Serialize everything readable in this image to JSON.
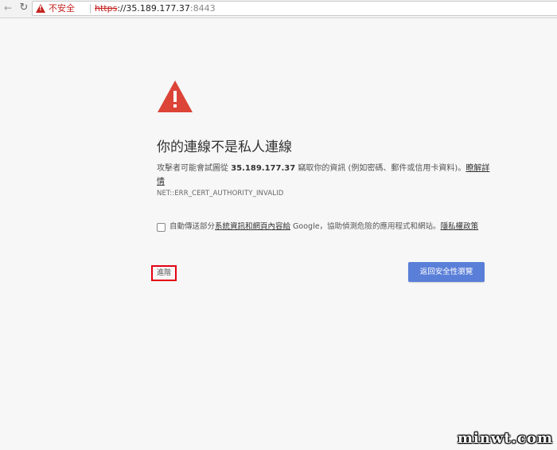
{
  "browser": {
    "back_icon": "←",
    "reload_icon": "↻",
    "not_secure_label": "不安全",
    "url_scheme": "https",
    "url_host": "://35.189.177.37",
    "url_port": ":8443"
  },
  "interstitial": {
    "heading": "你的連線不是私人連線",
    "message_before": "攻擊者可能會試圖從 ",
    "message_host": "35.189.177.37",
    "message_after": " 竊取你的資訊 (例如密碼、郵件或信用卡資料)。",
    "learn_more": "瞭解詳情",
    "error_code": "NET::ERR_CERT_AUTHORITY_INVALID",
    "report_before": "自動傳送部分",
    "report_link": "系統資訊和網頁內容給",
    "report_after": " Google，協助偵測危險的應用程式和網站。",
    "privacy_link": "隱私權政策",
    "advanced_button": "進階",
    "back_to_safety_button": "返回安全性瀏覽",
    "warning_color": "#db4437",
    "primary_button_color": "#5a7fd8"
  },
  "watermark": "minwt.com"
}
